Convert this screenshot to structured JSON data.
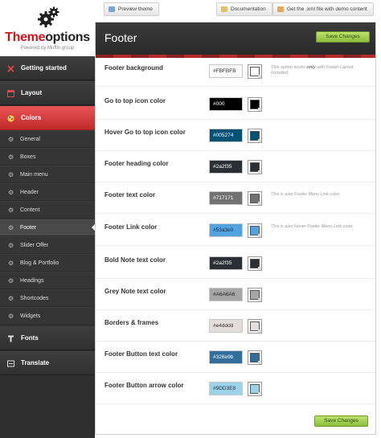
{
  "toolbar": {
    "preview": "Preview theme",
    "documentation": "Documentation",
    "xml": "Get the .xml file with demo content"
  },
  "logo": {
    "title_part1": "Theme",
    "title_part2": "options",
    "subtitle": "Powered by Muffin group"
  },
  "sidebar": {
    "getting_started": "Getting started",
    "layout": "Layout",
    "colors": "Colors",
    "sub": [
      "General",
      "Boxes",
      "Main menu",
      "Header",
      "Content",
      "Footer",
      "Slider Offer",
      "Blog & Portfolio",
      "Headings",
      "Shortcodes",
      "Widgets"
    ],
    "fonts": "Fonts",
    "translate": "Translate"
  },
  "panel": {
    "title": "Footer",
    "save_label": "Save Changes"
  },
  "options": [
    {
      "label": "Footer background",
      "hex": "#FBFBFB",
      "color": "#FBFBFB",
      "text_color": "#333333",
      "note_pre": "This option works ",
      "note_bold": "only",
      "note_post": " with Footer Layout: Included."
    },
    {
      "label": "Go to top icon color",
      "hex": "#000",
      "color": "#000000",
      "text_color": "#ffffff",
      "note_pre": "",
      "note_bold": "",
      "note_post": ""
    },
    {
      "label": "Hover Go to top icon color",
      "hex": "#005274",
      "color": "#005274",
      "text_color": "#ffffff",
      "note_pre": "",
      "note_bold": "",
      "note_post": ""
    },
    {
      "label": "Footer heading color",
      "hex": "#2a2f35",
      "color": "#2a2f35",
      "text_color": "#ffffff",
      "note_pre": "",
      "note_bold": "",
      "note_post": ""
    },
    {
      "label": "Footer text color",
      "hex": "#717171",
      "color": "#717171",
      "text_color": "#ffffff",
      "note_pre": "This is also Footer Menu Link color.",
      "note_bold": "",
      "note_post": ""
    },
    {
      "label": "Footer Link color",
      "hex": "#53a3e0",
      "color": "#53a3e0",
      "text_color": "#1a2a3a",
      "note_pre": "This is also Hover Footer Menu Link color.",
      "note_bold": "",
      "note_post": ""
    },
    {
      "label": "Bold Note text color",
      "hex": "#2a2f35",
      "color": "#2a2f35",
      "text_color": "#ffffff",
      "note_pre": "",
      "note_bold": "",
      "note_post": ""
    },
    {
      "label": "Grey Note text color",
      "hex": "#A6A6A6",
      "color": "#A6A6A6",
      "text_color": "#222222",
      "note_pre": "",
      "note_bold": "",
      "note_post": ""
    },
    {
      "label": "Borders & frames",
      "hex": "#e4dddd",
      "color": "#e4dddd",
      "text_color": "#333333",
      "note_pre": "",
      "note_bold": "",
      "note_post": ""
    },
    {
      "label": "Footer Button text color",
      "hex": "#326e9b",
      "color": "#326e9b",
      "text_color": "#ffffff",
      "note_pre": "",
      "note_bold": "",
      "note_post": ""
    },
    {
      "label": "Footer Button arrow color",
      "hex": "#9DD3E8",
      "color": "#9DD3E8",
      "text_color": "#223344",
      "note_pre": "",
      "note_bold": "",
      "note_post": ""
    }
  ]
}
